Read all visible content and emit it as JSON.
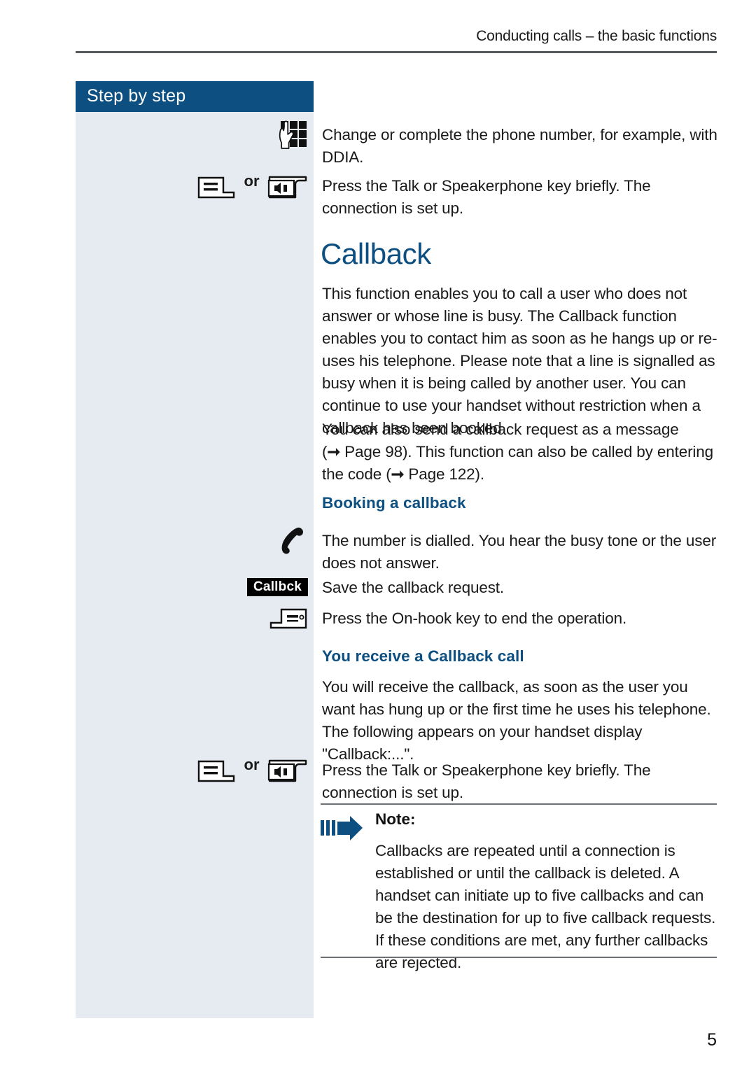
{
  "page": {
    "running_header": "Conducting calls – the basic functions",
    "page_number": "5",
    "accent_color": "#0d4f80",
    "sidebar_bg": "#e5ebf1"
  },
  "sidebar": {
    "title": "Step by step"
  },
  "steps_top": [
    {
      "icon": "keypad-icon",
      "text": "Change or complete the phone number, for example, with DDIA."
    },
    {
      "icon": "talk-key-icon",
      "or_label": "or",
      "icon2": "speakerphone-key-icon",
      "text": "Press the Talk or Speakerphone key briefly. The connection is set up."
    }
  ],
  "main": {
    "heading": "Callback",
    "intro_paragraph_1": "This function enables you to call a user who does not answer or whose line is busy. The Callback function enables you to contact him as soon as he hangs up or re-uses his telephone. Please note that a line is signalled as busy when it is being called by another user. You can continue to use your handset without restriction when a callback has been booked.",
    "intro_paragraph_2_part1": "You can also send a callback request as a message (",
    "intro_paragraph_2_ref1": "Page 98",
    "intro_paragraph_2_part2": "). This function can also be called by entering the code (",
    "intro_paragraph_2_ref2": "Page 122",
    "intro_paragraph_2_part3": ")."
  },
  "section_booking": {
    "heading": "Booking a callback",
    "rows": [
      {
        "icon": "handset-icon",
        "text": "The number is dialled. You hear the busy tone or the user does not answer."
      },
      {
        "softkey_label": "Callbck",
        "text": "Save the callback request."
      },
      {
        "icon": "on-hook-key-icon",
        "text": "Press the On-hook key to end the operation."
      }
    ]
  },
  "section_receive": {
    "heading": "You receive a Callback call",
    "paragraph": "You will receive the callback, as soon as the user you want has hung up or the first time he uses his telephone. The following appears on your handset display \"Callback:...\".",
    "row": {
      "icon": "talk-key-icon",
      "or_label": "or",
      "icon2": "speakerphone-key-icon",
      "text": "Press the Talk or Speakerphone key briefly. The connection is set up."
    }
  },
  "note": {
    "icon": "note-arrow-icon",
    "title": "Note:",
    "body": "Callbacks are repeated until a connection is established or until the callback is deleted. A handset can initiate up to five callbacks and can be the destination for up to five callback requests. If these conditions are met, any further callbacks are rejected."
  }
}
